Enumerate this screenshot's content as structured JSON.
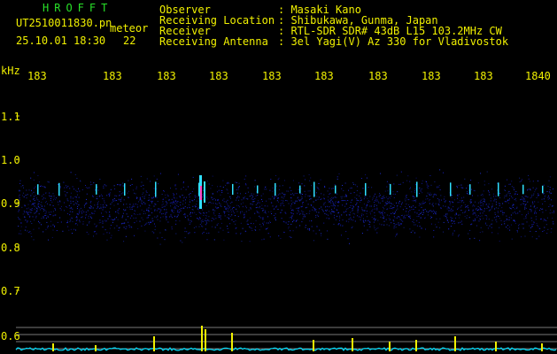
{
  "header": {
    "logo": "HROFFT",
    "filename": "UT2510011830.pn",
    "meteor_label": "meteor",
    "datetime": "25.10.01 18:30",
    "meteor_count": "22",
    "info_labels": {
      "observer": "Observer",
      "location": "Receiving Location",
      "receiver": "Receiver",
      "antenna": "Receiving Antenna"
    },
    "info_values": {
      "observer": ": Masaki Kano",
      "location": ": Shibukawa, Gunma, Japan",
      "receiver": ": RTL-SDR SDR# 43dB L15 103.2MHz CW",
      "antenna": ": 3el Yagi(V) Az 330 for Vladivostok"
    }
  },
  "axes": {
    "y_unit": "kHz",
    "y_ticks": [
      "1.1",
      "1.0",
      "0.9",
      "0.8",
      "0.7",
      "0.6"
    ],
    "time_ticks": [
      "183",
      "183",
      "183",
      "183",
      "183",
      "183",
      "183",
      "183",
      "183",
      "1840"
    ]
  },
  "colors": {
    "background": "#000000",
    "text_yellow": "#f0f000",
    "logo_green": "#28e028",
    "noise_blue": "#1820c0",
    "signal_cyan": "#30e0ff",
    "signal_magenta": "#ff40c0",
    "trace_yellow": "#f0f000",
    "trace_cyan": "#00e0ff"
  }
}
